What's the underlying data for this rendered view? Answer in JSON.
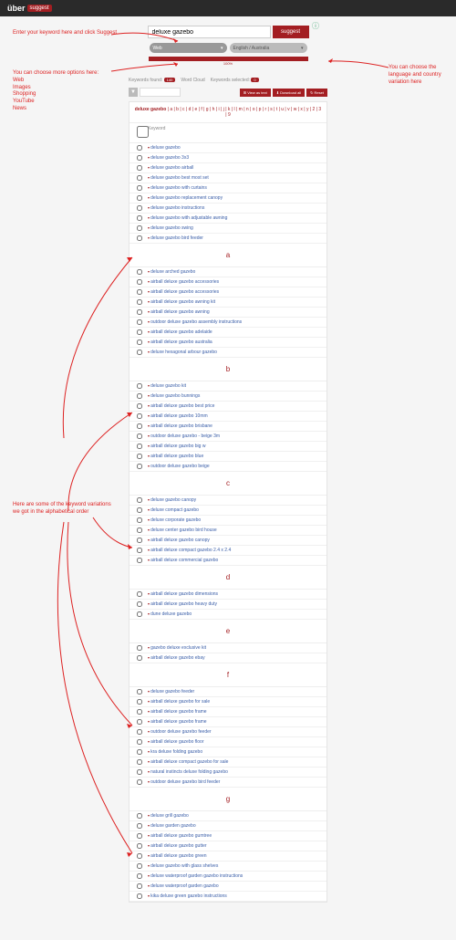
{
  "logo": "über",
  "logo_badge": "suggest",
  "search": {
    "value": "deluxe gazebo",
    "button": "suggest"
  },
  "dropdown1": "Web",
  "dropdown2": "English / Australia",
  "progress_label": "100%",
  "tabs": {
    "t1": "Keywords found:",
    "b1": "140",
    "t2": "Word Cloud",
    "t3": "Keywords selected:",
    "b3": "0"
  },
  "actions": {
    "view": "⊞ View as text",
    "download": "⬇ Download all",
    "reset": "↻ Reset"
  },
  "alpha_prefix": "deluxe gazebo",
  "alpha_letters": "a | b | c | d | e | f | g | h | i | j | k | l | m | n | o | p | r | s | t | u | v | w | x | y | 2 | 3 | 9",
  "col_keyword": "Keyword",
  "annotations": {
    "a1": "Enter your keyword here and click Suggest",
    "a2": "You can choose more options here:\nWeb\nImages\nShopping\nYouTube\nNews",
    "a3": "You can choose the language and country variation here",
    "a4": "Here are some of the keyword variations we got in the alphabetical order"
  },
  "groups": [
    {
      "letter": "",
      "kws": [
        "deluxe gazebo",
        "deluxe gazebo 3x3",
        "deluxe gazebo airball",
        "deluxe gazebo best most set",
        "deluxe gazebo with curtains",
        "deluxe gazebo replacement canopy",
        "deluxe gazebo instructions",
        "deluxe gazebo with adjustable awning",
        "deluxe gazebo swing",
        "deluxe gazebo bird feeder"
      ]
    },
    {
      "letter": "a",
      "kws": [
        "deluxe arched gazebo",
        "airball deluxe gazebo accessories",
        "airball deluxe gazebo accessories",
        "airball deluxe gazebo awning kit",
        "airball deluxe gazebo awning",
        "outdoor deluxe gazebo assembly instructions",
        "airball deluxe gazebo adelaide",
        "airball deluxe gazebo australia",
        "deluxe hexagonal arbour gazebo"
      ]
    },
    {
      "letter": "b",
      "kws": [
        "deluxe gazebo kit",
        "deluxe gazebo bunnings",
        "airball deluxe gazebo best price",
        "airball deluxe gazebo 10mm",
        "airball deluxe gazebo brisbane",
        "outdoor deluxe gazebo - beige 3m",
        "airball deluxe gazebo big w",
        "airball deluxe gazebo blue",
        "outdoor deluxe gazebo beige"
      ]
    },
    {
      "letter": "c",
      "kws": [
        "deluxe gazebo canopy",
        "deluxe compact gazebo",
        "deluxe corporate gazebo",
        "deluxe center gazebo bird house",
        "airball deluxe gazebo canopy",
        "airball deluxe compact gazebo 2.4 x 2.4",
        "airball deluxe commercial gazebo"
      ]
    },
    {
      "letter": "d",
      "kws": [
        "airball deluxe gazebo dimensions",
        "airball deluxe gazebo heavy duty",
        "dune deluxe gazebo"
      ]
    },
    {
      "letter": "e",
      "kws": [
        "gazebo deluxe exclusive kit",
        "airball deluxe gazebo ebay"
      ]
    },
    {
      "letter": "f",
      "kws": [
        "deluxe gazebo feeder",
        "airball deluxe gazebo for sale",
        "airball deluxe gazebo frame",
        "airball deluxe gazebo frame",
        "outdoor deluxe gazebo feeder",
        "airball deluxe gazebo floor",
        "kra deluxe folding gazebo",
        "airball deluxe compact gazebo for sale",
        "natural instincts deluxe folding gazebo",
        "outdoor deluxe gazebo bird feeder"
      ]
    },
    {
      "letter": "g",
      "kws": [
        "deluxe grill gazebo",
        "deluxe garden gazebo",
        "airball deluxe gazebo gumtree",
        "airball deluxe gazebo gutter",
        "airball deluxe gazebo green",
        "deluxe gazebo with glass shelves",
        "deluxe waterproof garden gazebo instructions",
        "deluxe waterproof garden gazebo",
        "kika deluxe green gazebo instructions"
      ]
    }
  ]
}
